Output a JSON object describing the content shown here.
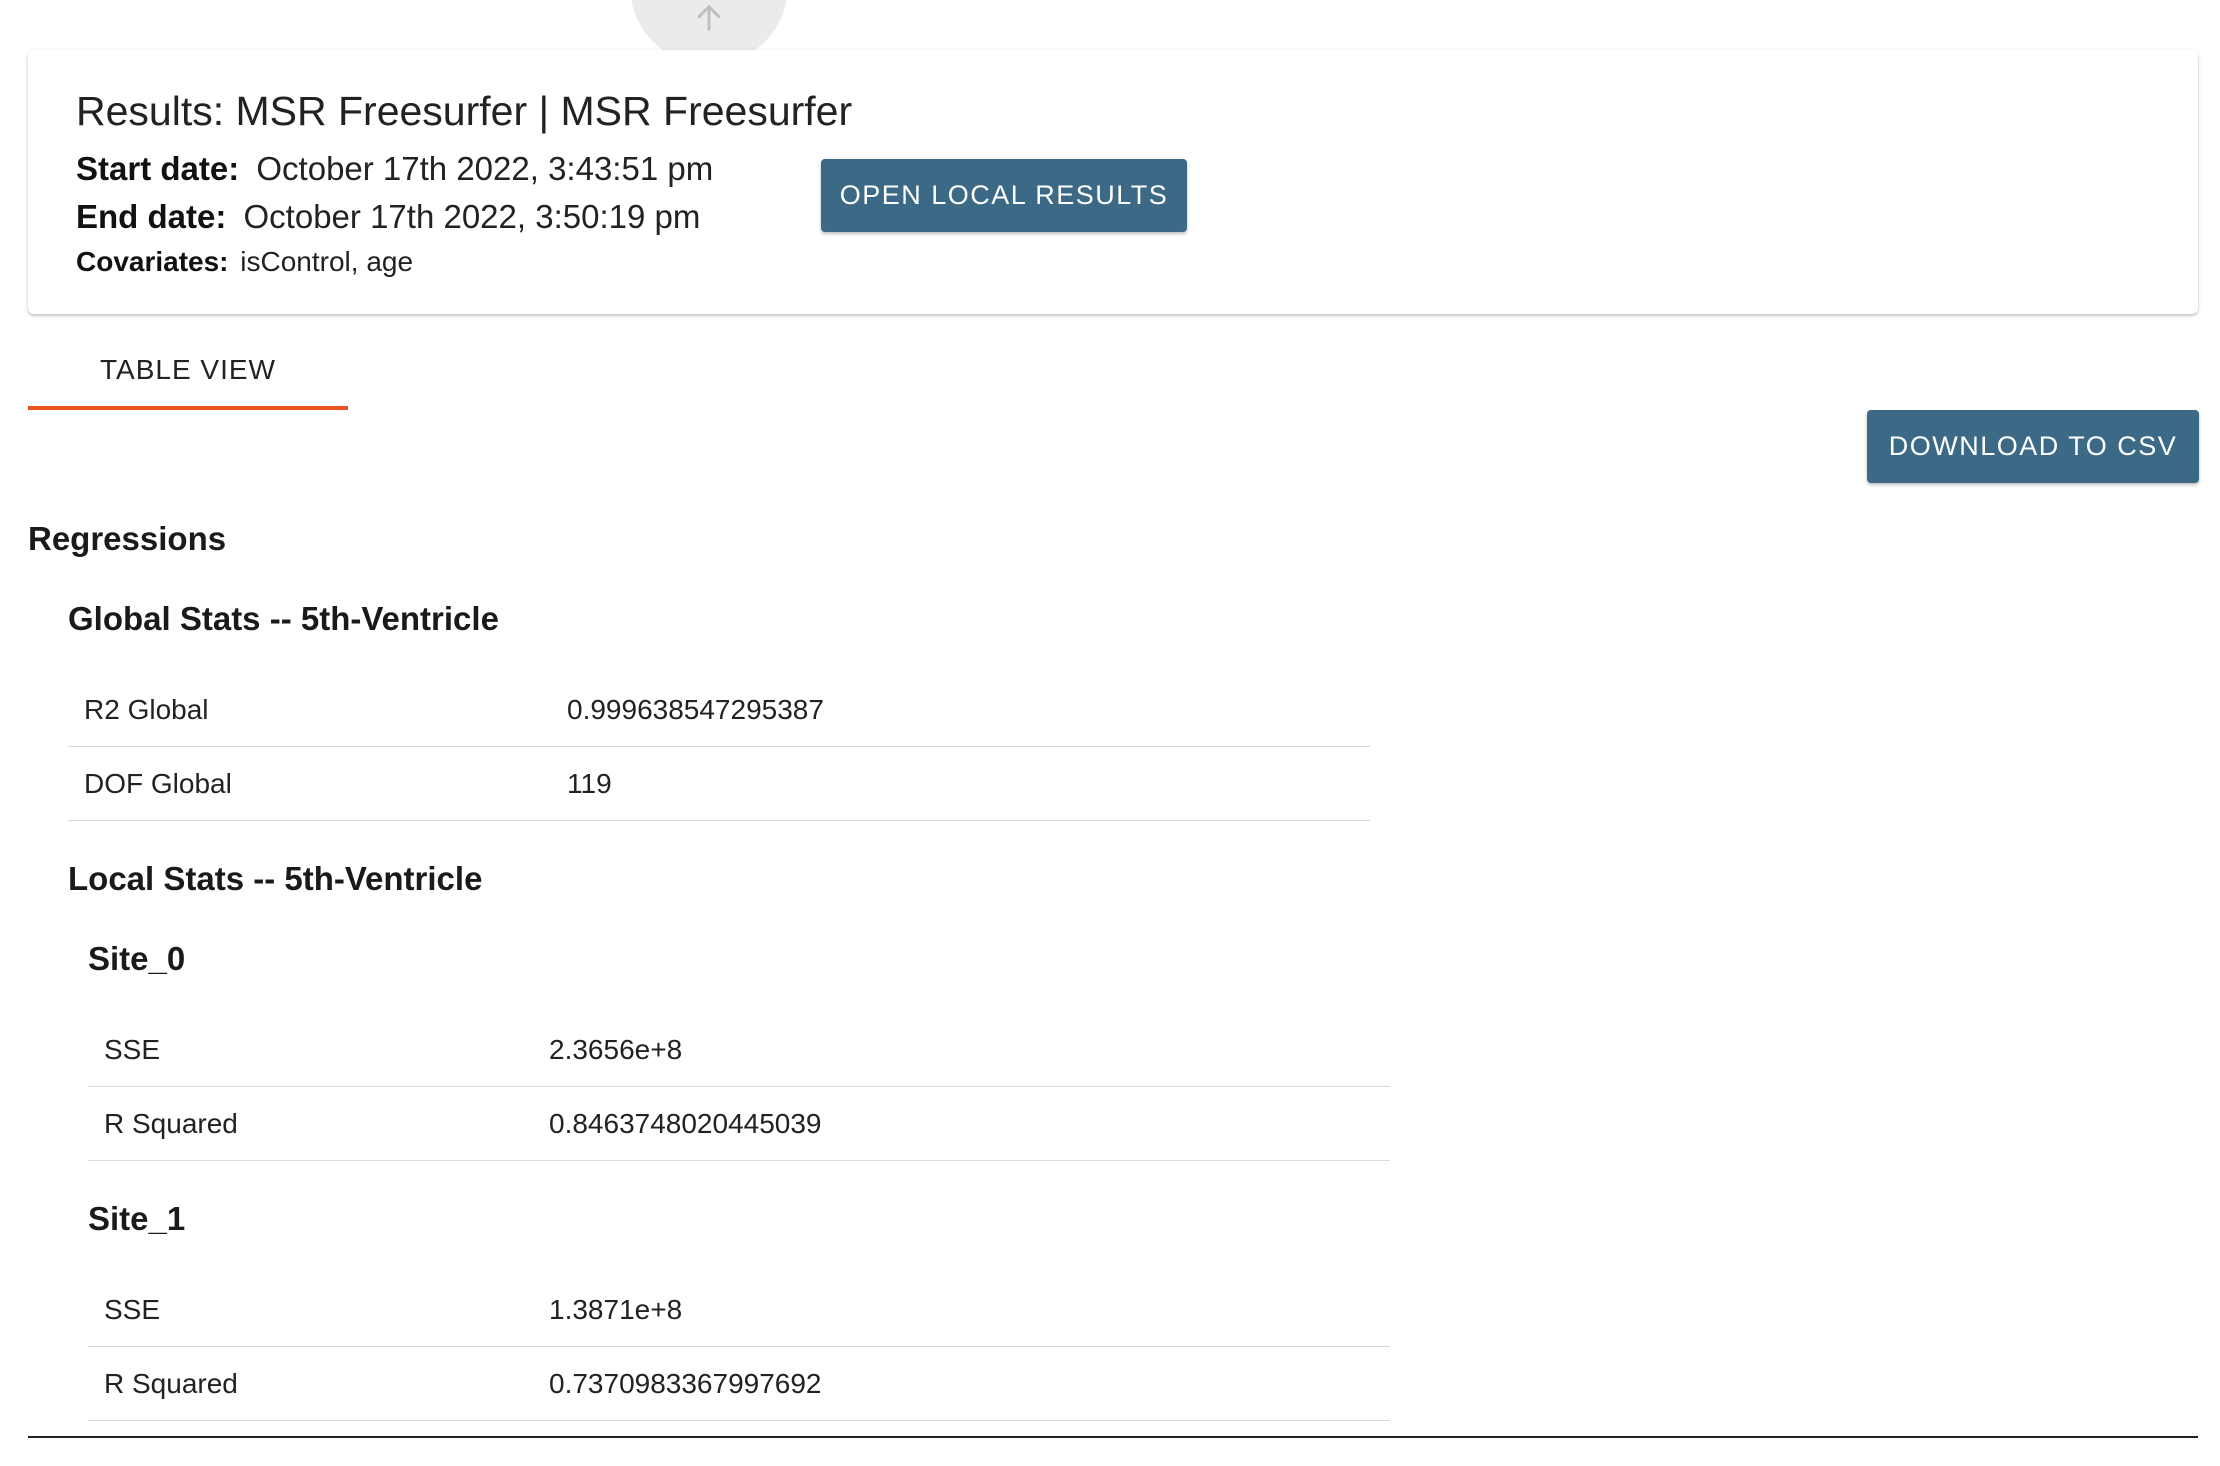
{
  "header": {
    "title": "Results: MSR Freesurfer | MSR Freesurfer",
    "start_label": "Start date:",
    "start_value": "October 17th 2022, 3:43:51 pm",
    "end_label": "End date:",
    "end_value": "October 17th 2022, 3:50:19 pm",
    "covariates_label": "Covariates:",
    "covariates_value": "isControl, age",
    "open_local_label": "OPEN LOCAL RESULTS"
  },
  "tabs": [
    {
      "label": "TABLE VIEW",
      "active": true
    }
  ],
  "download_label": "DOWNLOAD TO CSV",
  "regressions": {
    "heading": "Regressions",
    "global": {
      "heading": "Global Stats -- 5th-Ventricle",
      "rows": [
        {
          "key": "R2 Global",
          "value": "0.999638547295387"
        },
        {
          "key": "DOF Global",
          "value": "119"
        }
      ]
    },
    "local": {
      "heading": "Local Stats -- 5th-Ventricle",
      "sites": [
        {
          "name": "Site_0",
          "rows": [
            {
              "key": "SSE",
              "value": "2.3656e+8"
            },
            {
              "key": "R Squared",
              "value": "0.8463748020445039"
            }
          ]
        },
        {
          "name": "Site_1",
          "rows": [
            {
              "key": "SSE",
              "value": "1.3871e+8"
            },
            {
              "key": "R Squared",
              "value": "0.7370983367997692"
            }
          ]
        }
      ]
    }
  },
  "colors": {
    "button": "#3c6a86",
    "tab_indicator": "#e8551c"
  },
  "icons": {
    "scroll_top": "arrow-up-icon"
  }
}
